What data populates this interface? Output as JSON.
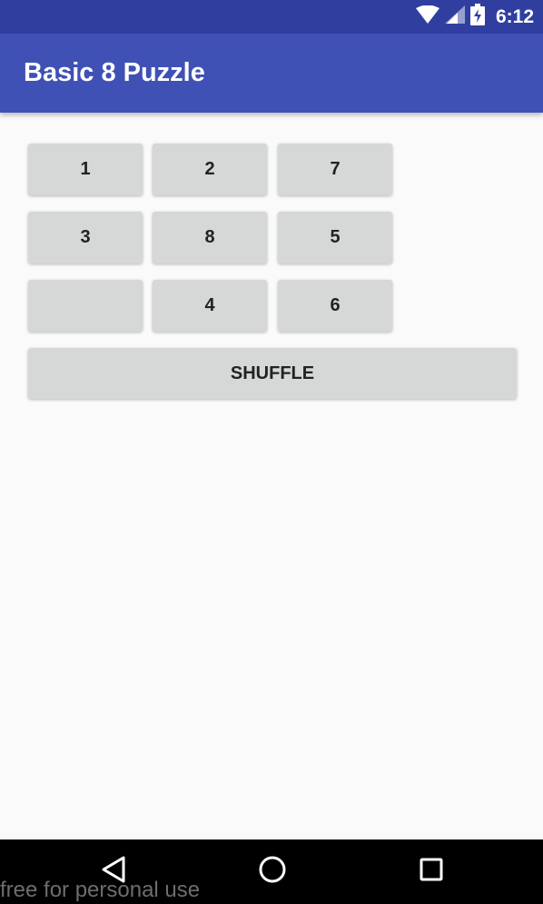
{
  "status_bar": {
    "time": "6:12",
    "icons": [
      "wifi-icon",
      "signal-icon",
      "battery-charging-icon"
    ]
  },
  "app_bar": {
    "title": "Basic 8 Puzzle",
    "color": "#3f51b5"
  },
  "puzzle": {
    "tiles": [
      "1",
      "2",
      "7",
      "3",
      "8",
      "5",
      "",
      "4",
      "6"
    ],
    "shuffle_label": "SHUFFLE"
  },
  "nav_bar": {
    "buttons": [
      "back-icon",
      "home-icon",
      "recents-icon"
    ]
  },
  "watermark": "free for personal use"
}
